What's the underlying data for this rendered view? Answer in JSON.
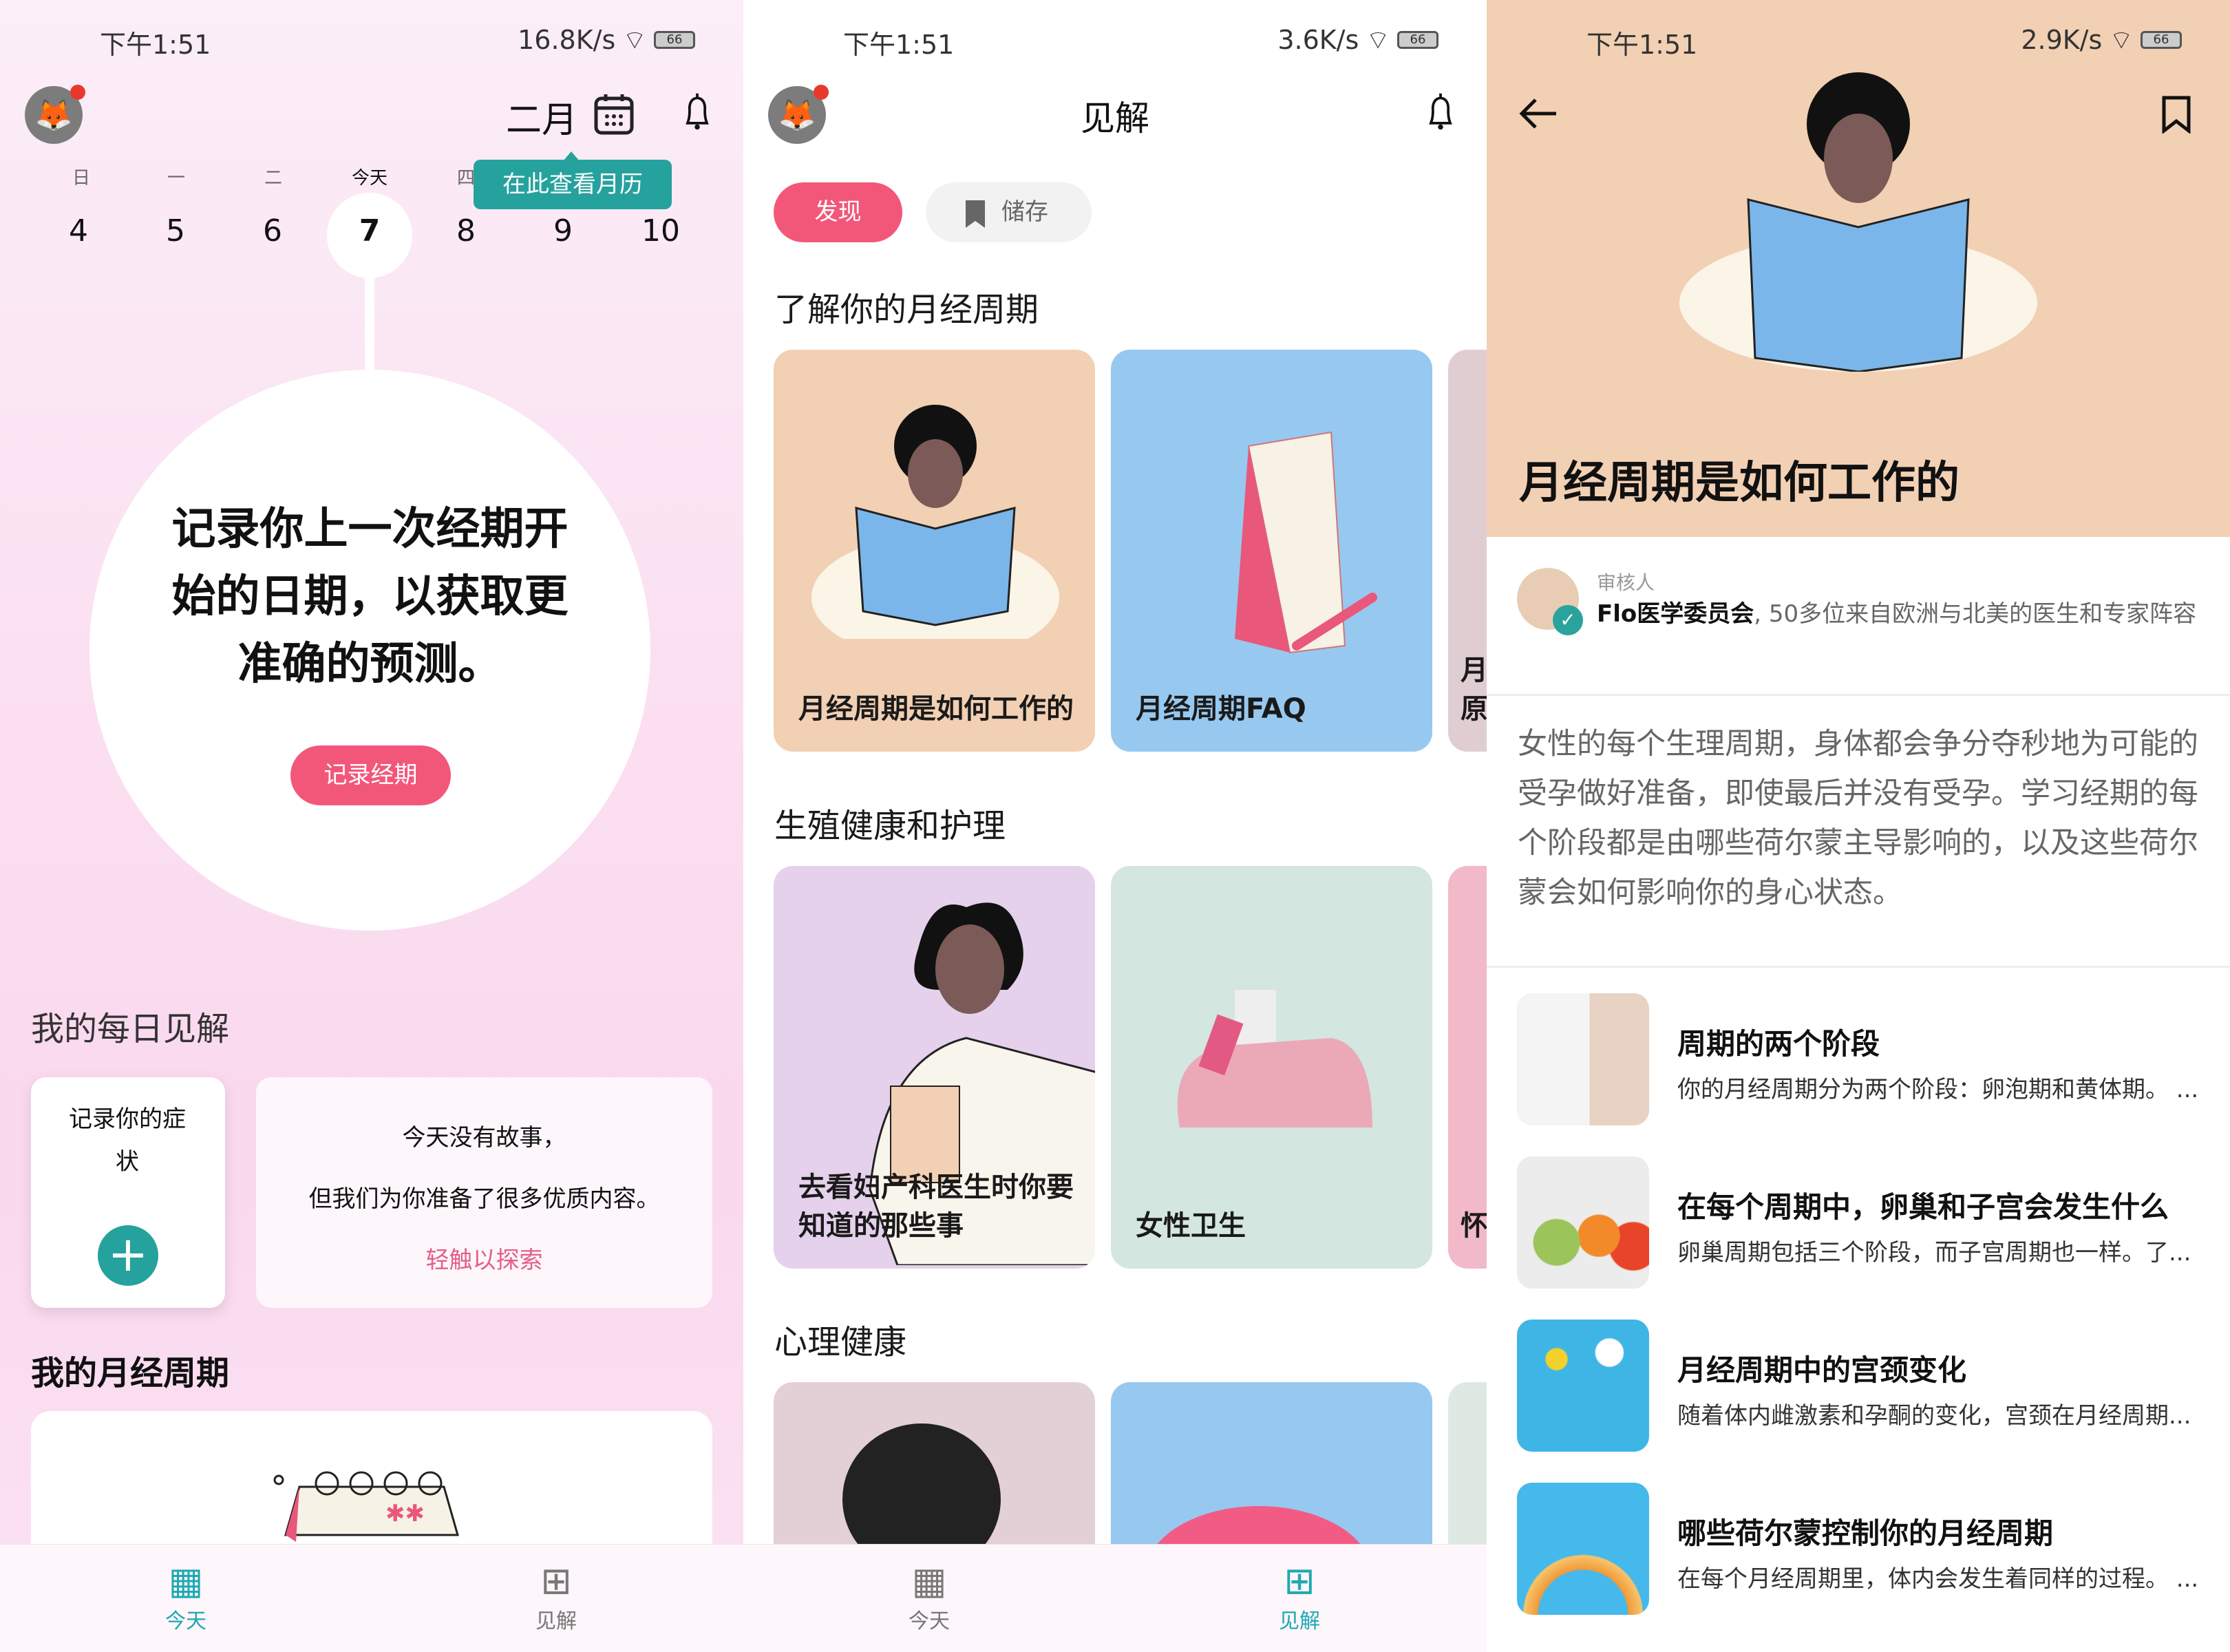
{
  "colors": {
    "accent_pink": "#f2577a",
    "teal": "#26a29e",
    "peach": "#f2d0b4"
  },
  "panels": [
    {
      "status": {
        "time": "下午1:51",
        "speed": "16.8K/s",
        "battery": "66"
      }
    },
    {
      "status": {
        "time": "下午1:51",
        "speed": "3.6K/s",
        "battery": "66"
      }
    },
    {
      "status": {
        "time": "下午1:51",
        "speed": "2.9K/s",
        "battery": "66"
      }
    }
  ],
  "today": {
    "month": "二月",
    "tooltip": "在此查看月历",
    "weekdays": [
      "日",
      "一",
      "二",
      "今天",
      "四"
    ],
    "dates": [
      "4",
      "5",
      "6",
      "7",
      "8",
      "9",
      "10"
    ],
    "prompt_lines": [
      "记录你上一次经期开",
      "始的日期，以获取更",
      "准确的预测。"
    ],
    "log_period_button": "记录经期",
    "daily_insights_title": "我的每日见解",
    "symptom_card": "记录你的症状",
    "story_card": {
      "line1": "今天没有故事，",
      "line2": "但我们为你准备了很多优质内容。",
      "link": "轻触以探索"
    },
    "cycle_title": "我的月经周期"
  },
  "nav": {
    "today": "今天",
    "insights": "见解"
  },
  "insights": {
    "title": "见解",
    "chips": {
      "discover": "发现",
      "saved": "储存"
    },
    "sections": [
      {
        "title": "了解你的月经周期",
        "cards": [
          "月经周期是如何工作的",
          "月经周期FAQ",
          "月\n原"
        ]
      },
      {
        "title": "生殖健康和护理",
        "cards": [
          "去看妇产科医生时你要知道的那些事",
          "女性卫生",
          "怀"
        ]
      },
      {
        "title": "心理健康",
        "cards": [
          "",
          "",
          ""
        ]
      }
    ]
  },
  "article": {
    "title": "月经周期是如何工作的",
    "reviewer_label": "审核人",
    "reviewer_name": "Flo医学委员会",
    "reviewer_desc": ", 50多位来自欧洲与北美的医生和专家阵容",
    "body": "女性的每个生理周期，身体都会争分夺秒地为可能的受孕做好准备，即使最后并没有受孕。学习经期的每个阶段都是由哪些荷尔蒙主导影响的，以及这些荷尔蒙会如何影响你的身心状态。",
    "related": [
      {
        "title": "周期的两个阶段",
        "desc": "你的月经周期分为两个阶段：卵泡期和黄体期。 ..."
      },
      {
        "title": "在每个周期中，卵巢和子宫会发生什么",
        "desc": "卵巢周期包括三个阶段，而子宫周期也一样。了..."
      },
      {
        "title": "月经周期中的宫颈变化",
        "desc": "随着体内雌激素和孕酮的变化，宫颈在月经周期..."
      },
      {
        "title": "哪些荷尔蒙控制你的月经周期",
        "desc": "在每个月经周期里，体内会发生着同样的过程。 ..."
      }
    ]
  }
}
